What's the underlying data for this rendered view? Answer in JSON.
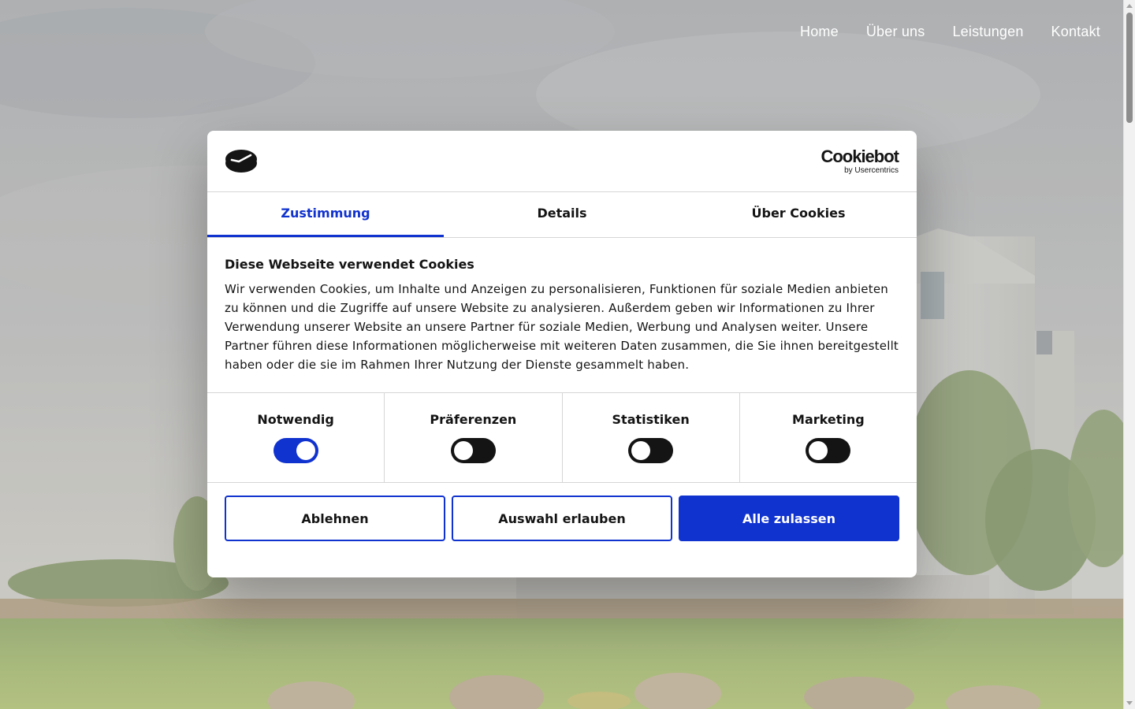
{
  "nav": {
    "items": [
      "Home",
      "Über uns",
      "Leistungen",
      "Kontakt"
    ]
  },
  "cookie_dialog": {
    "brand": {
      "name": "Cookiebot",
      "sub": "by Usercentrics"
    },
    "tabs": [
      {
        "label": "Zustimmung",
        "active": true
      },
      {
        "label": "Details",
        "active": false
      },
      {
        "label": "Über Cookies",
        "active": false
      }
    ],
    "heading": "Diese Webseite verwendet Cookies",
    "text": "Wir verwenden Cookies, um Inhalte und Anzeigen zu personalisieren, Funktionen für soziale Medien anbieten zu können und die Zugriffe auf unsere Website zu analysieren. Außerdem geben wir Informationen zu Ihrer Verwendung unserer Website an unsere Partner für soziale Medien, Werbung und Analysen weiter. Unsere Partner führen diese Informationen möglicherweise mit weiteren Daten zusammen, die Sie ihnen bereitgestellt haben oder die sie im Rahmen Ihrer Nutzung der Dienste gesammelt haben.",
    "toggles": [
      {
        "label": "Notwendig",
        "on": true
      },
      {
        "label": "Präferenzen",
        "on": false
      },
      {
        "label": "Statistiken",
        "on": false
      },
      {
        "label": "Marketing",
        "on": false
      }
    ],
    "buttons": {
      "decline": "Ablehnen",
      "allow_selection": "Auswahl erlauben",
      "allow_all": "Alle zulassen"
    }
  },
  "colors": {
    "accent": "#1032cf",
    "text": "#141414",
    "divider": "#d6d6d6"
  }
}
